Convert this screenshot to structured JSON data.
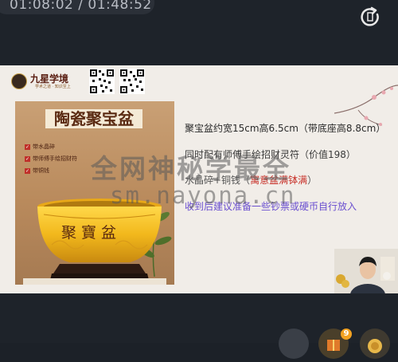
{
  "player": {
    "time_display": "01:08:02 / 01:48:52"
  },
  "slide": {
    "brand": {
      "name": "九星学境",
      "tagline": "学术之道 · 知识至上"
    },
    "poster": {
      "title": "陶瓷聚宝盆",
      "features": [
        "带水晶碎",
        "带师傅手绘招财符",
        "带铜钱"
      ],
      "bowl_text": "聚寶盆"
    },
    "info": {
      "line1": "聚宝盆约宽15cm高6.5cm（带底座高8.8cm）",
      "line2": "同时配有师傅手绘招财灵符（价值198）",
      "line3_prefix": "水晶碎+铜钱（",
      "line3_highlight": "寓意盆满钵满",
      "line3_suffix": "）",
      "line4": "收到后建议准备一些钞票或硬币自行放入"
    },
    "watermark": {
      "line1": "全网神秘学最全",
      "line2": "sm.nayona.cn"
    }
  },
  "controls": {
    "notification_count": "9"
  },
  "colors": {
    "accent_red": "#c8322a",
    "accent_purple": "#6a4fd0",
    "badge": "#f2a120"
  }
}
